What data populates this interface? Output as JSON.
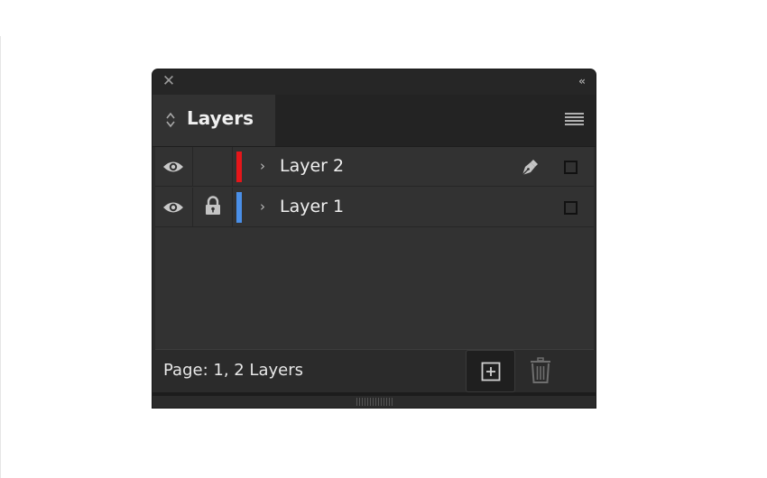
{
  "panel": {
    "close_icon": "close-icon",
    "collapse_glyph": "‹‹",
    "tab_label": "Layers",
    "menu_icon": "hamburger-menu-icon"
  },
  "layers": [
    {
      "name": "Layer 2",
      "visible": true,
      "locked": false,
      "color": "#e5161a",
      "expand_glyph": "›",
      "active_pen": true
    },
    {
      "name": "Layer 1",
      "visible": true,
      "locked": true,
      "color": "#4a8fe8",
      "expand_glyph": "›",
      "active_pen": false
    }
  ],
  "footer": {
    "status": "Page: 1, 2 Layers",
    "new_layer_icon": "new-layer-icon",
    "delete_icon": "trash-icon"
  }
}
